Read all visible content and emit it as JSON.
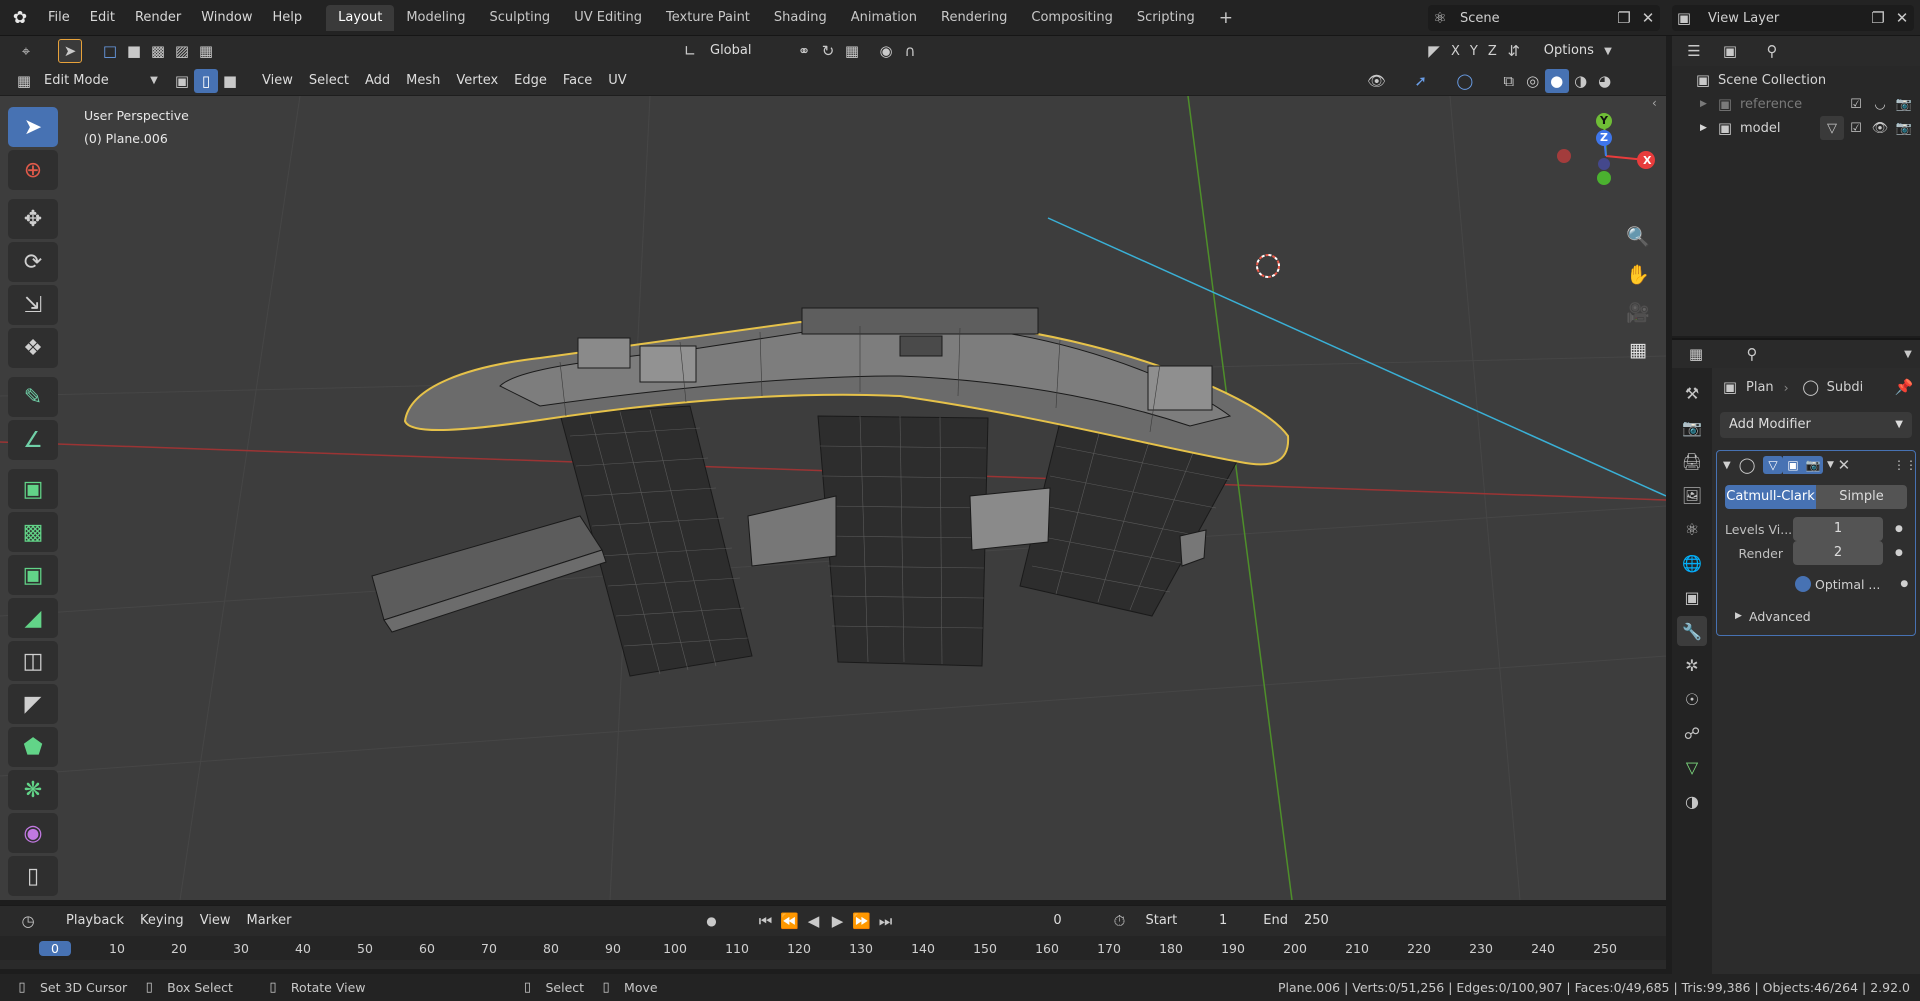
{
  "topbar": {
    "menus": [
      "File",
      "Edit",
      "Render",
      "Window",
      "Help"
    ],
    "workspaces": [
      "Layout",
      "Modeling",
      "Sculpting",
      "UV Editing",
      "Texture Paint",
      "Shading",
      "Animation",
      "Rendering",
      "Compositing",
      "Scripting"
    ],
    "active_workspace": "Layout",
    "add_workspace": "+",
    "scene_label": "Scene",
    "view_layer_label": "View Layer"
  },
  "viewport_header": {
    "transform_orientation": "Global",
    "axes": [
      "X",
      "Y",
      "Z"
    ],
    "options_label": "Options",
    "mode_label": "Edit Mode",
    "menus": [
      "View",
      "Select",
      "Add",
      "Mesh",
      "Vertex",
      "Edge",
      "Face",
      "UV"
    ]
  },
  "viewport": {
    "perspective_label": "User Perspective",
    "object_label": "(0) Plane.006",
    "gizmo": {
      "x": "X",
      "y": "Y",
      "z": "Z"
    }
  },
  "toolbar": {
    "tools": [
      "select-box",
      "cursor",
      "move",
      "rotate",
      "scale",
      "transform",
      "annotate",
      "measure",
      "add-cube",
      "extrude",
      "inset",
      "bevel",
      "loop-cut",
      "knife",
      "poly-build",
      "spin",
      "smooth",
      "shear"
    ]
  },
  "timeline": {
    "menus": [
      "Playback",
      "Keying",
      "View",
      "Marker"
    ],
    "current_frame": "0",
    "start_label": "Start",
    "start_value": "1",
    "end_label": "End",
    "end_value": "250",
    "ruler": [
      "0",
      "10",
      "20",
      "30",
      "40",
      "50",
      "60",
      "70",
      "80",
      "90",
      "100",
      "110",
      "120",
      "130",
      "140",
      "150",
      "160",
      "170",
      "180",
      "190",
      "200",
      "210",
      "220",
      "230",
      "240",
      "250"
    ]
  },
  "outliner": {
    "root": "Scene Collection",
    "collections": [
      {
        "name": "reference"
      },
      {
        "name": "model"
      }
    ]
  },
  "properties": {
    "breadcrumb_object": "Plan",
    "breadcrumb_modifier": "Subdi",
    "add_modifier_label": "Add Modifier",
    "subdiv_type_active": "Catmull-Clark",
    "subdiv_type_other": "Simple",
    "levels_viewport_label": "Levels Vi...",
    "levels_viewport_value": "1",
    "render_label": "Render",
    "render_value": "2",
    "optimal_label": "Optimal ...",
    "advanced_label": "Advanced"
  },
  "statusbar": {
    "hint_left1": "Set 3D Cursor",
    "hint_left2": "Box Select",
    "hint_left3": "Rotate View",
    "hint_mid1": "Select",
    "hint_mid2": "Move",
    "stats": "Plane.006 | Verts:0/51,256 | Edges:0/100,907 | Faces:0/49,685 | Tris:99,386 | Objects:46/264 | 2.92.0"
  },
  "colors": {
    "accent": "#4772b3",
    "x_axis": "#e83c3c",
    "y_axis": "#6fbd36",
    "z_axis": "#3f76ea",
    "selection_outline": "#e6c24a"
  }
}
